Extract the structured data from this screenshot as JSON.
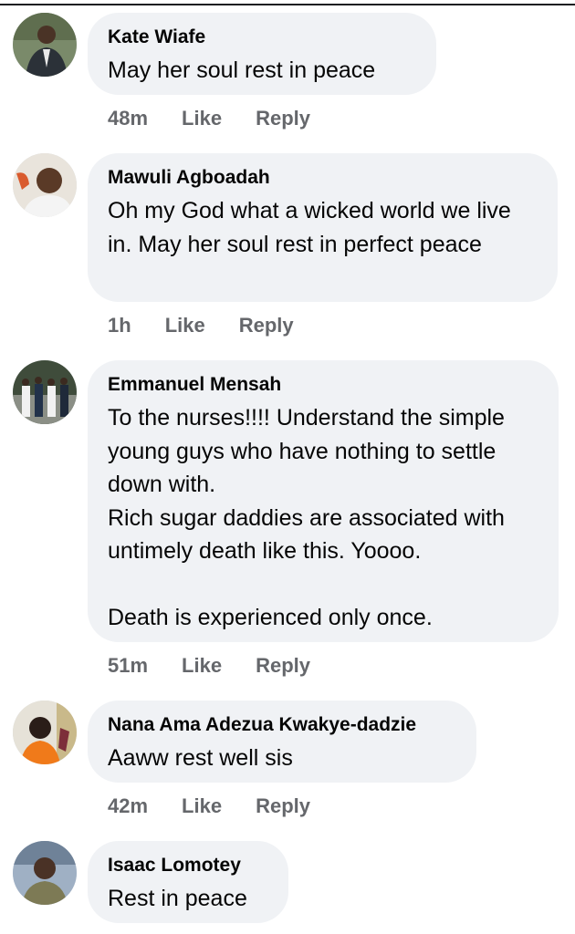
{
  "comments": [
    {
      "author": "Kate Wiafe",
      "text": "May her soul rest in peace",
      "time": "48m",
      "like_label": "Like",
      "reply_label": "Reply"
    },
    {
      "author": "Mawuli Agboadah",
      "text": "Oh my God what a wicked world we live in. May her soul rest in perfect peace",
      "time": "1h",
      "like_label": "Like",
      "reply_label": "Reply"
    },
    {
      "author": "Emmanuel Mensah",
      "text": "To the nurses!!!! Understand the simple young guys who have nothing to settle down with.\nRich sugar daddies are associated with untimely death like this. Yoooo.\n\nDeath is experienced only once.",
      "time": "51m",
      "like_label": "Like",
      "reply_label": "Reply"
    },
    {
      "author": "Nana Ama Adezua Kwakye-dadzie",
      "text": "Aaww rest well sis",
      "time": "42m",
      "like_label": "Like",
      "reply_label": "Reply"
    },
    {
      "author": "Isaac Lomotey",
      "text": "Rest in peace",
      "time": "",
      "like_label": "",
      "reply_label": ""
    }
  ]
}
